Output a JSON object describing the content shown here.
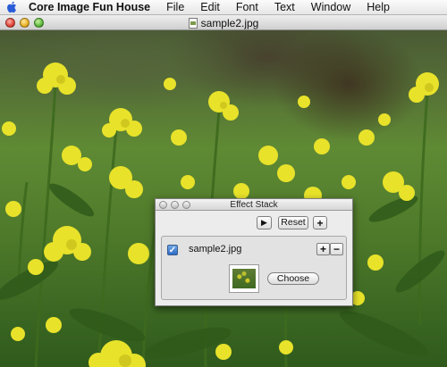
{
  "menubar": {
    "apple_icon": "apple-logo-icon",
    "app_name": "Core Image Fun House",
    "items": [
      "File",
      "Edit",
      "Font",
      "Text",
      "Window",
      "Help"
    ]
  },
  "window": {
    "title": "sample2.jpg",
    "title_icon": "document-icon"
  },
  "effect_stack": {
    "title": "Effect Stack",
    "play_glyph": "▶",
    "reset_label": "Reset",
    "add_label": "+",
    "effect": {
      "checked": true,
      "check_glyph": "✓",
      "name": "sample2.jpg",
      "plus_label": "+",
      "minus_label": "−",
      "choose_label": "Choose"
    }
  },
  "colors": {
    "flowers": "#e8e22a",
    "foliage": "#4f7a2a",
    "checkbox_blue": "#2d6cc6"
  }
}
